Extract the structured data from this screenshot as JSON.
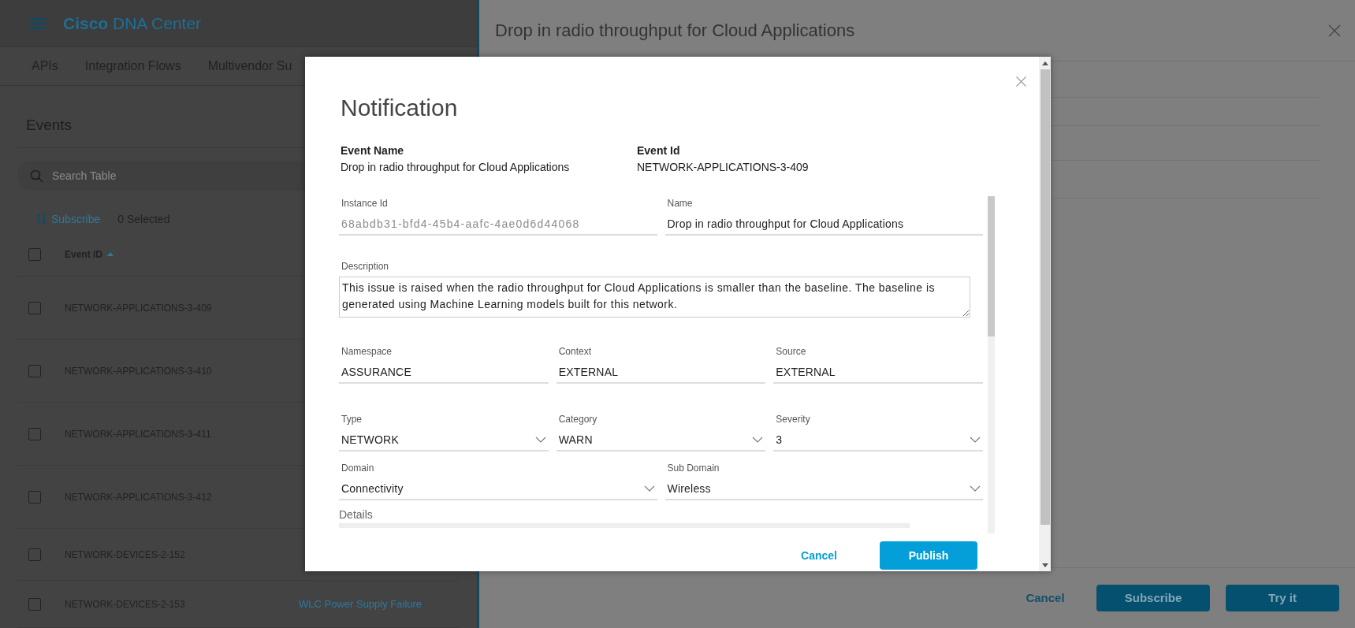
{
  "app": {
    "brand": "Cisco",
    "product": "DNA Center"
  },
  "tabs": [
    {
      "label": "APIs"
    },
    {
      "label": "Integration Flows"
    },
    {
      "label": "Multivendor Su"
    }
  ],
  "events": {
    "title": "Events",
    "search": {
      "placeholder": "Search Table"
    },
    "subscribe": "Subscribe",
    "selected_count": "0 Selected",
    "select_all": {
      "checked": false
    },
    "columns": [
      {
        "label": "Event ID"
      }
    ],
    "rows": [
      {
        "event_id": "NETWORK-APPLICATIONS-3-409",
        "checked": false
      },
      {
        "event_id": "NETWORK-APPLICATIONS-3-410",
        "checked": false
      },
      {
        "event_id": "NETWORK-APPLICATIONS-3-411",
        "checked": false
      },
      {
        "event_id": "NETWORK-APPLICATIONS-3-412",
        "checked": false
      },
      {
        "event_id": "NETWORK-DEVICES-2-152",
        "checked": false
      },
      {
        "event_id": "NETWORK-DEVICES-2-153",
        "checked": false,
        "name": "WLC Power Supply Failure"
      }
    ]
  },
  "drawer": {
    "title": "Drop in radio throughput for Cloud Applications",
    "buttons": [
      {
        "label": "Cancel",
        "kind": "link"
      },
      {
        "label": "Subscribe",
        "kind": "primary"
      },
      {
        "label": "Try it",
        "kind": "primary"
      }
    ]
  },
  "modal": {
    "title": "Notification",
    "summary": [
      {
        "label": "Event Name",
        "value": "Drop in radio throughput for Cloud Applications"
      },
      {
        "label": "Event Id",
        "value": "NETWORK-APPLICATIONS-3-409"
      }
    ],
    "field_rows": [
      [
        {
          "label": "Instance Id",
          "value": "68abdb31-bfd4-45b4-aafc-4ae0d6d44068",
          "kind": "text",
          "disabled": true
        },
        {
          "label": "Name",
          "value": "Drop in radio throughput for Cloud Applications",
          "kind": "text",
          "disabled": false
        }
      ],
      [
        {
          "label": "Description",
          "value": "This issue is raised when the radio throughput for Cloud Applications is smaller than the baseline. The baseline is generated using Machine Learning models built for this network.",
          "kind": "textarea",
          "disabled": false
        }
      ],
      [
        {
          "label": "Namespace",
          "value": "ASSURANCE",
          "kind": "text",
          "disabled": false
        },
        {
          "label": "Context",
          "value": "EXTERNAL",
          "kind": "text",
          "disabled": false
        },
        {
          "label": "Source",
          "value": "EXTERNAL",
          "kind": "text",
          "disabled": false
        }
      ],
      [
        {
          "label": "Type",
          "value": "NETWORK",
          "kind": "select",
          "disabled": false
        },
        {
          "label": "Category",
          "value": "WARN",
          "kind": "select",
          "disabled": false
        },
        {
          "label": "Severity",
          "value": "3",
          "kind": "select",
          "disabled": false
        }
      ],
      [
        {
          "label": "Domain",
          "value": "Connectivity",
          "kind": "select",
          "disabled": false
        },
        {
          "label": "Sub Domain",
          "value": "Wireless",
          "kind": "select",
          "disabled": false
        }
      ]
    ],
    "details_label": "Details",
    "buttons": [
      {
        "label": "Cancel",
        "kind": "link"
      },
      {
        "label": "Publish",
        "kind": "primary"
      }
    ]
  }
}
